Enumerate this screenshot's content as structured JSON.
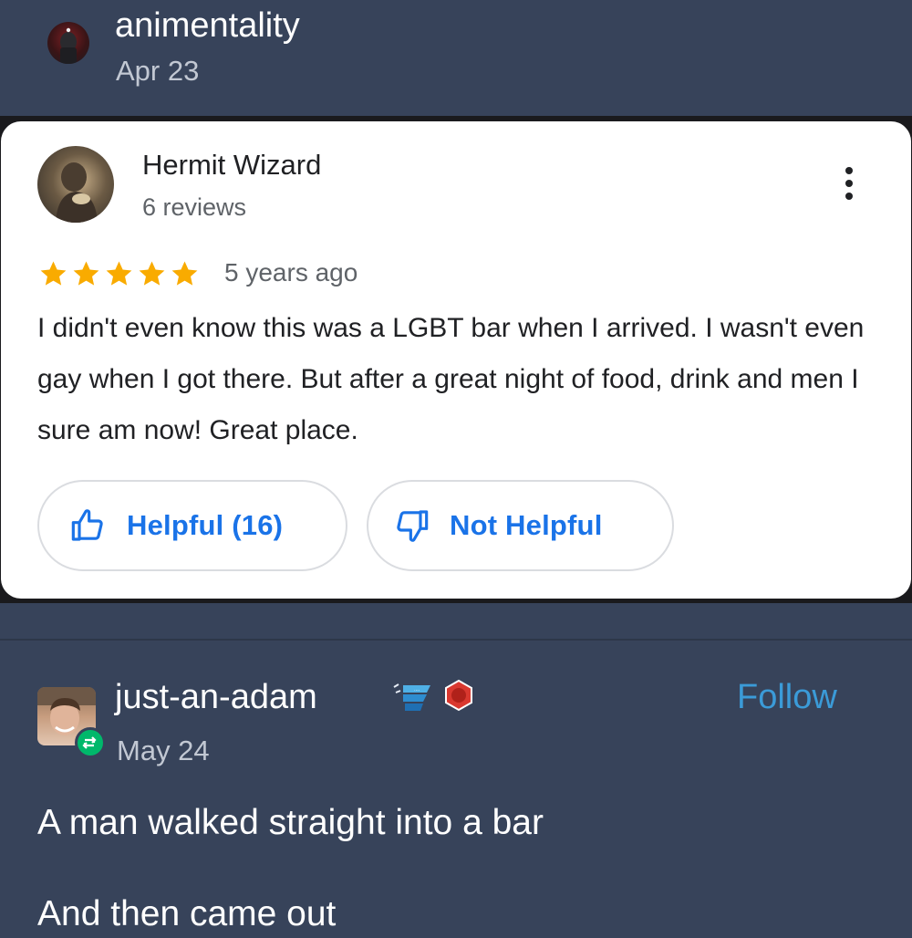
{
  "original_post": {
    "author": "animentality",
    "date": "Apr 23"
  },
  "review": {
    "reviewer_name": "Hermit Wizard",
    "reviewer_reviews": "6 reviews",
    "rating": 5,
    "rating_max": 5,
    "time_ago": "5 years ago",
    "text": "I didn't even know this was a LGBT bar when I arrived. I wasn't even gay when I got there. But after a great night of food, drink and men I sure am now! Great place.",
    "helpful_label": "Helpful (16)",
    "not_helpful_label": "Not Helpful"
  },
  "reblog": {
    "author": "just-an-adam",
    "date": "May 24",
    "follow_label": "Follow",
    "body_lines": [
      "A man walked straight into a bar",
      "And then came out"
    ]
  },
  "icons": {
    "more": "more-vert-icon",
    "star": "star-icon",
    "thumbs_up": "thumbs-up-icon",
    "thumbs_down": "thumbs-down-icon",
    "reblog": "reblog-icon"
  },
  "colors": {
    "background": "#37435a",
    "card": "#ffffff",
    "star": "#f9ab00",
    "link_blue": "#1a73e8",
    "follow_blue": "#3b9bd8",
    "reblog_green": "#00b86b"
  }
}
